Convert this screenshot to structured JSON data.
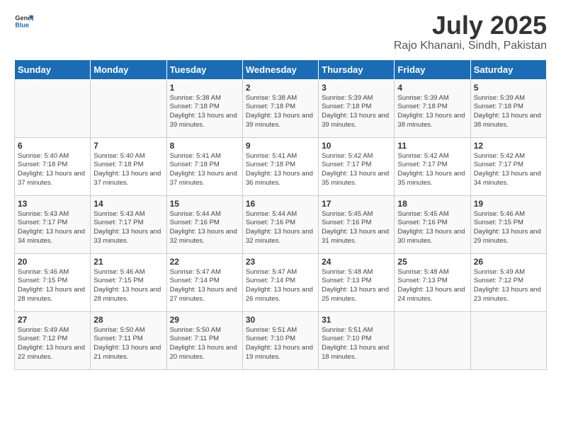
{
  "logo": {
    "line1": "General",
    "line2": "Blue"
  },
  "title": "July 2025",
  "subtitle": "Rajo Khanani, Sindh, Pakistan",
  "days_of_week": [
    "Sunday",
    "Monday",
    "Tuesday",
    "Wednesday",
    "Thursday",
    "Friday",
    "Saturday"
  ],
  "weeks": [
    [
      {
        "day": "",
        "content": ""
      },
      {
        "day": "",
        "content": ""
      },
      {
        "day": "1",
        "content": "Sunrise: 5:38 AM\nSunset: 7:18 PM\nDaylight: 13 hours and 39 minutes."
      },
      {
        "day": "2",
        "content": "Sunrise: 5:38 AM\nSunset: 7:18 PM\nDaylight: 13 hours and 39 minutes."
      },
      {
        "day": "3",
        "content": "Sunrise: 5:39 AM\nSunset: 7:18 PM\nDaylight: 13 hours and 39 minutes."
      },
      {
        "day": "4",
        "content": "Sunrise: 5:39 AM\nSunset: 7:18 PM\nDaylight: 13 hours and 38 minutes."
      },
      {
        "day": "5",
        "content": "Sunrise: 5:39 AM\nSunset: 7:18 PM\nDaylight: 13 hours and 38 minutes."
      }
    ],
    [
      {
        "day": "6",
        "content": "Sunrise: 5:40 AM\nSunset: 7:18 PM\nDaylight: 13 hours and 37 minutes."
      },
      {
        "day": "7",
        "content": "Sunrise: 5:40 AM\nSunset: 7:18 PM\nDaylight: 13 hours and 37 minutes."
      },
      {
        "day": "8",
        "content": "Sunrise: 5:41 AM\nSunset: 7:18 PM\nDaylight: 13 hours and 37 minutes."
      },
      {
        "day": "9",
        "content": "Sunrise: 5:41 AM\nSunset: 7:18 PM\nDaylight: 13 hours and 36 minutes."
      },
      {
        "day": "10",
        "content": "Sunrise: 5:42 AM\nSunset: 7:17 PM\nDaylight: 13 hours and 35 minutes."
      },
      {
        "day": "11",
        "content": "Sunrise: 5:42 AM\nSunset: 7:17 PM\nDaylight: 13 hours and 35 minutes."
      },
      {
        "day": "12",
        "content": "Sunrise: 5:42 AM\nSunset: 7:17 PM\nDaylight: 13 hours and 34 minutes."
      }
    ],
    [
      {
        "day": "13",
        "content": "Sunrise: 5:43 AM\nSunset: 7:17 PM\nDaylight: 13 hours and 34 minutes."
      },
      {
        "day": "14",
        "content": "Sunrise: 5:43 AM\nSunset: 7:17 PM\nDaylight: 13 hours and 33 minutes."
      },
      {
        "day": "15",
        "content": "Sunrise: 5:44 AM\nSunset: 7:16 PM\nDaylight: 13 hours and 32 minutes."
      },
      {
        "day": "16",
        "content": "Sunrise: 5:44 AM\nSunset: 7:16 PM\nDaylight: 13 hours and 32 minutes."
      },
      {
        "day": "17",
        "content": "Sunrise: 5:45 AM\nSunset: 7:16 PM\nDaylight: 13 hours and 31 minutes."
      },
      {
        "day": "18",
        "content": "Sunrise: 5:45 AM\nSunset: 7:16 PM\nDaylight: 13 hours and 30 minutes."
      },
      {
        "day": "19",
        "content": "Sunrise: 5:46 AM\nSunset: 7:15 PM\nDaylight: 13 hours and 29 minutes."
      }
    ],
    [
      {
        "day": "20",
        "content": "Sunrise: 5:46 AM\nSunset: 7:15 PM\nDaylight: 13 hours and 28 minutes."
      },
      {
        "day": "21",
        "content": "Sunrise: 5:46 AM\nSunset: 7:15 PM\nDaylight: 13 hours and 28 minutes."
      },
      {
        "day": "22",
        "content": "Sunrise: 5:47 AM\nSunset: 7:14 PM\nDaylight: 13 hours and 27 minutes."
      },
      {
        "day": "23",
        "content": "Sunrise: 5:47 AM\nSunset: 7:14 PM\nDaylight: 13 hours and 26 minutes."
      },
      {
        "day": "24",
        "content": "Sunrise: 5:48 AM\nSunset: 7:13 PM\nDaylight: 13 hours and 25 minutes."
      },
      {
        "day": "25",
        "content": "Sunrise: 5:48 AM\nSunset: 7:13 PM\nDaylight: 13 hours and 24 minutes."
      },
      {
        "day": "26",
        "content": "Sunrise: 5:49 AM\nSunset: 7:12 PM\nDaylight: 13 hours and 23 minutes."
      }
    ],
    [
      {
        "day": "27",
        "content": "Sunrise: 5:49 AM\nSunset: 7:12 PM\nDaylight: 13 hours and 22 minutes."
      },
      {
        "day": "28",
        "content": "Sunrise: 5:50 AM\nSunset: 7:11 PM\nDaylight: 13 hours and 21 minutes."
      },
      {
        "day": "29",
        "content": "Sunrise: 5:50 AM\nSunset: 7:11 PM\nDaylight: 13 hours and 20 minutes."
      },
      {
        "day": "30",
        "content": "Sunrise: 5:51 AM\nSunset: 7:10 PM\nDaylight: 13 hours and 19 minutes."
      },
      {
        "day": "31",
        "content": "Sunrise: 5:51 AM\nSunset: 7:10 PM\nDaylight: 13 hours and 18 minutes."
      },
      {
        "day": "",
        "content": ""
      },
      {
        "day": "",
        "content": ""
      }
    ]
  ]
}
